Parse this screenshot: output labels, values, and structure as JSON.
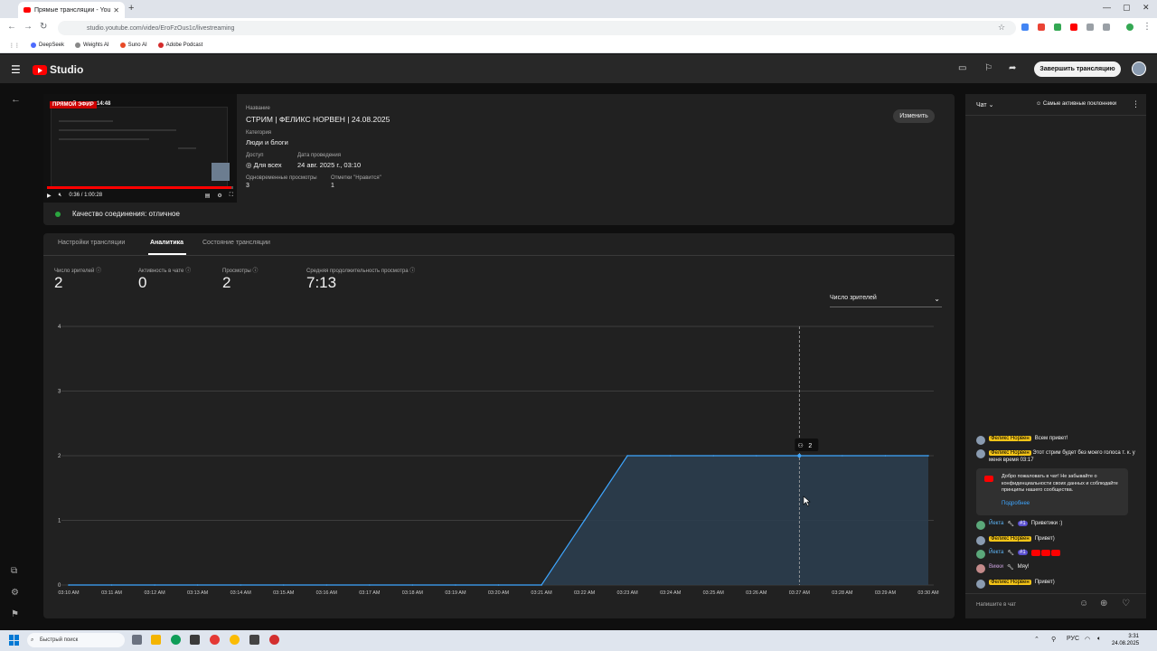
{
  "browser": {
    "tab_title": "Прямые трансляции - YouTube",
    "url": "studio.youtube.com/video/EroFzOus1c/livestreaming",
    "bookmarks": [
      "DeepSeek",
      "Weights AI",
      "Suno AI",
      "Adobe Podcast"
    ]
  },
  "header": {
    "logo_text": "Studio",
    "end_stream_label": "Завершить трансляцию"
  },
  "stream": {
    "live_badge": "ПРЯМОЙ ЭФИР",
    "live_time": "14:48",
    "player_time": "0:36 / 1:00:28",
    "progress": 0.99,
    "title_label": "Название",
    "title": "СТРИМ | ФЕЛИКС НОРВЕН | 24.08.2025",
    "category_label": "Категория",
    "category": "Люди и блоги",
    "access_label": "Доступ",
    "access": "Для всех",
    "date_label": "Дата проведения",
    "date": "24 авг. 2025 г., 03:10",
    "concurrent_label": "Одновременные просмотры",
    "concurrent": "3",
    "likes_label": "Отметки \"Нравится\"",
    "likes": "1",
    "edit_label": "Изменить",
    "connection": "Качество соединения: отличное"
  },
  "tabs": [
    {
      "label": "Настройки трансляции",
      "active": false
    },
    {
      "label": "Аналитика",
      "active": true
    },
    {
      "label": "Состояние трансляции",
      "active": false
    }
  ],
  "stats": [
    {
      "label": "Число зрителей",
      "value": "2"
    },
    {
      "label": "Активность в чате",
      "value": "0"
    },
    {
      "label": "Просмотры",
      "value": "2"
    },
    {
      "label": "Средняя продолжительность просмотра",
      "value": "7:13"
    }
  ],
  "metric_select": "Число зрителей",
  "chart_data": {
    "type": "area",
    "x": [
      "03:10 AM",
      "03:11 AM",
      "03:12 AM",
      "03:13 AM",
      "03:14 AM",
      "03:15 AM",
      "03:16 AM",
      "03:17 AM",
      "03:18 AM",
      "03:19 AM",
      "03:20 AM",
      "03:21 AM",
      "03:22 AM",
      "03:23 AM",
      "03:24 AM",
      "03:25 AM",
      "03:26 AM",
      "03:27 AM",
      "03:28 AM",
      "03:29 AM",
      "03:30 AM"
    ],
    "values": [
      0,
      0,
      0,
      0,
      0,
      0,
      0,
      0,
      0,
      0,
      0,
      0,
      1,
      2,
      2,
      2,
      2,
      2,
      2,
      2,
      2
    ],
    "y_ticks": [
      "0",
      "1",
      "2",
      "3",
      "4"
    ],
    "ylim": [
      0,
      4
    ],
    "grid": true,
    "line_color": "#3ea6ff",
    "fill_color": "#2c3e50",
    "tooltip": {
      "x_index": 17,
      "value": "2"
    }
  },
  "chat": {
    "title": "Чат",
    "filter": "Самые активные поклонники",
    "messages": [
      {
        "author": "Феликс Норвен",
        "text": "Всем привет!"
      },
      {
        "author": "Феликс Норвен",
        "text": "Этот стрим будет без моего голоса т. к. у меня время 03:17"
      },
      {
        "author": "Йекта",
        "badge": "#1",
        "text": "Приветики :)"
      },
      {
        "author": "Феликс Норвен",
        "text": "Привет)"
      },
      {
        "author": "Йекта",
        "badge": "#1",
        "text": ""
      },
      {
        "author": "Викки",
        "text": "Мяу!"
      },
      {
        "author": "Феликс Норвен",
        "text": "Привет)"
      }
    ],
    "welcome_text": "Добро пожаловать в чат! Не забывайте о конфиденциальности своих данных и соблюдайте принципы нашего сообщества.",
    "welcome_link": "Подробнее",
    "input_placeholder": "Напишите в чат"
  },
  "taskbar": {
    "search_placeholder": "Быстрый поиск",
    "lang": "РУС",
    "time": "3:31",
    "date": "24.08.2025"
  }
}
